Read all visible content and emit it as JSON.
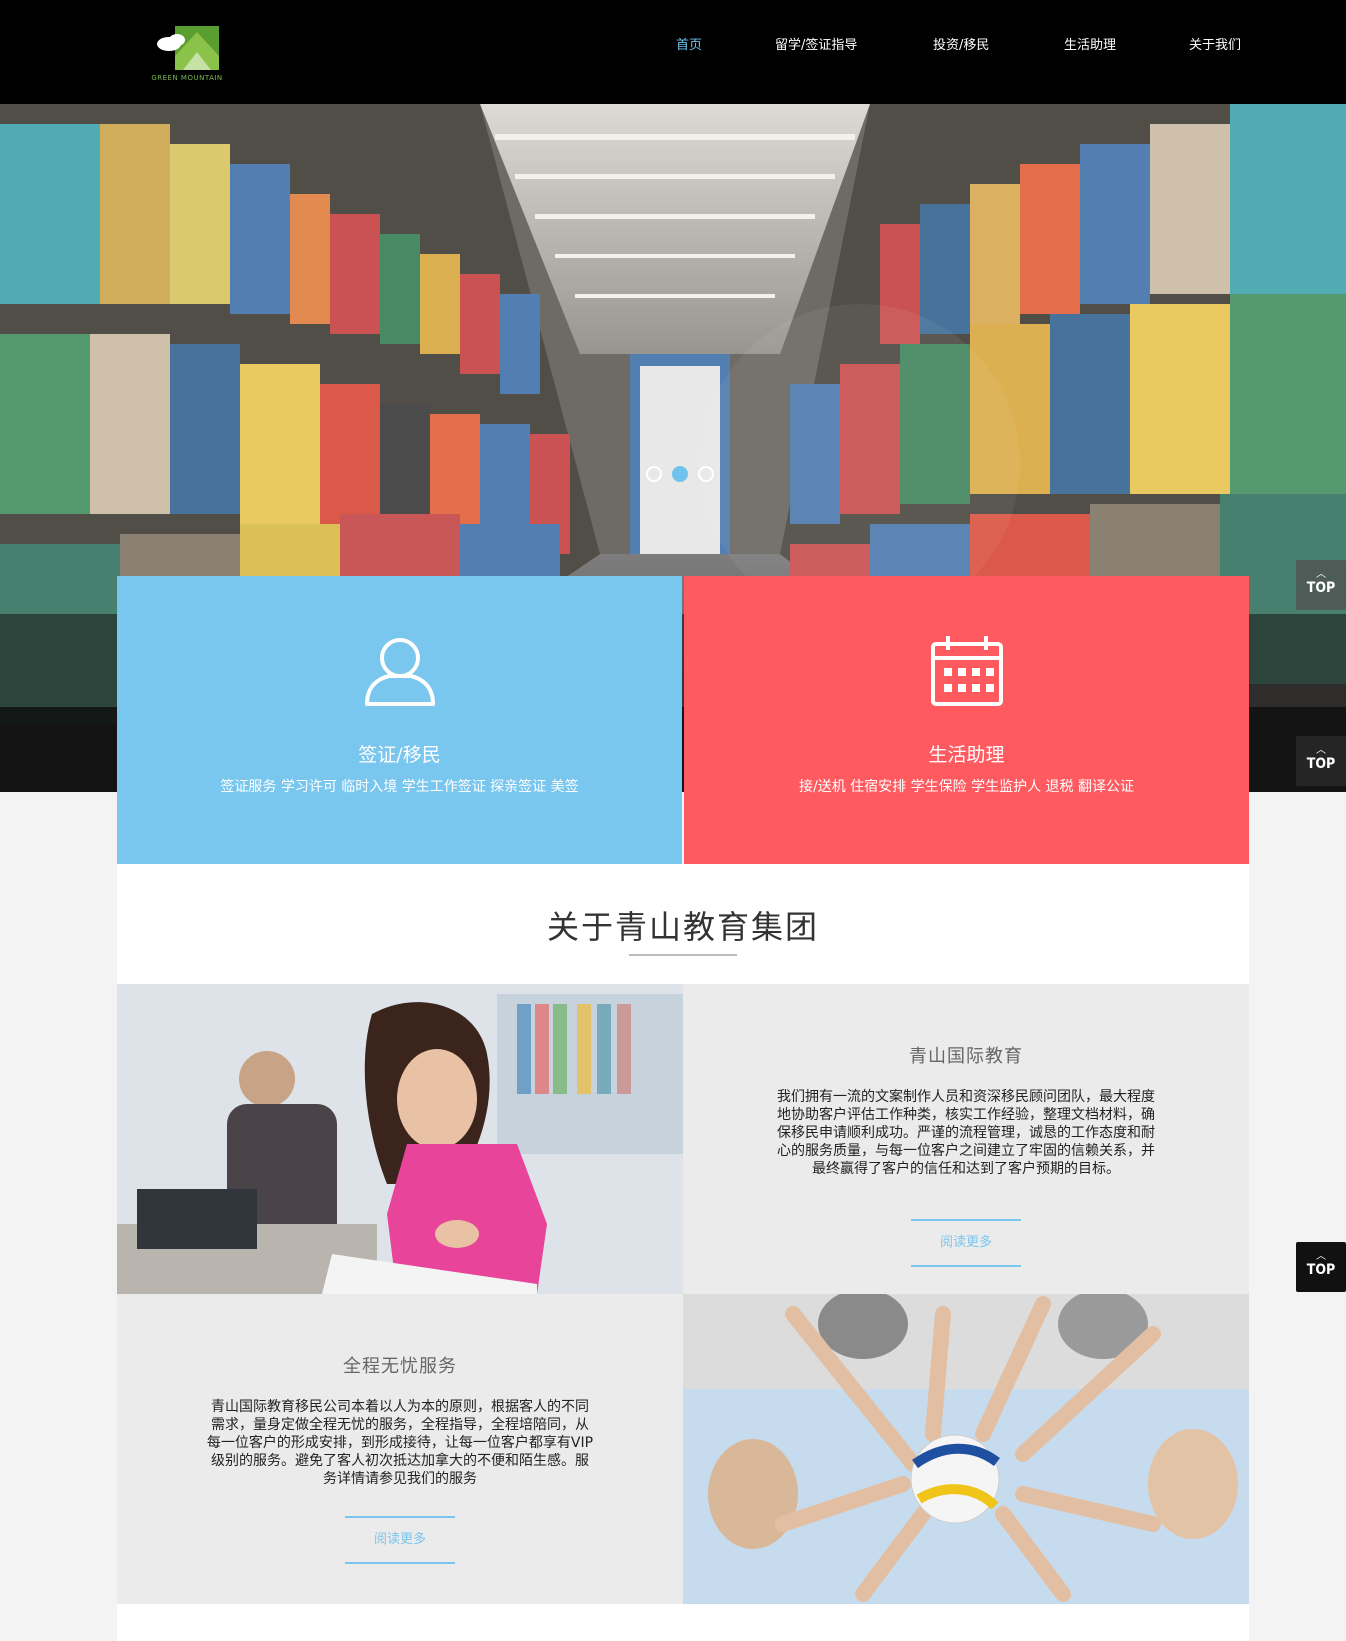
{
  "header": {
    "logo_text": "GREEN MOUNTAIN",
    "nav": [
      {
        "label": "首页",
        "active": true
      },
      {
        "label": "留学/签证指导"
      },
      {
        "label": "投资/移民"
      },
      {
        "label": "生活助理"
      },
      {
        "label": "关于我们"
      }
    ]
  },
  "hero": {
    "slides_count": 3,
    "active_slide": 2
  },
  "tiles": [
    {
      "title": "签证/移民",
      "subtitle": "签证服务 学习许可 临时入境 学生工作签证 探亲签证 美签",
      "color": "#79c6ee",
      "icon": "user-icon"
    },
    {
      "title": "生活助理",
      "subtitle": "接/送机 住宿安排 学生保险  学生监护人 退税 翻译公证",
      "color": "#ff5a60",
      "icon": "calendar-icon"
    }
  ],
  "about": {
    "title": "关于青山教育集团",
    "block1": {
      "heading": "青山国际教育",
      "body": "我们拥有一流的文案制作人员和资深移民顾问团队，最大程度地协助客户评估工作种类，核实工作经验，整理文档材料，确保移民申请顺利成功。严谨的流程管理，诚恳的工作态度和耐心的服务质量，与每一位客户之间建立了牢固的信赖关系，并最终赢得了客户的信任和达到了客户预期的目标。",
      "read_more": "阅读更多"
    },
    "block2": {
      "heading": "全程无忧服务",
      "body": "青山国际教育移民公司本着以人为本的原则，根据客人的不同需求，量身定做全程无忧的服务，全程指导，全程培陪同，从每一位客户的形成安排，到形成接待，让每一位客户都享有VIP级别的服务。避免了客人初次抵达加拿大的不便和陌生感。服务详情请参见我们的服务",
      "read_more": "阅读更多"
    }
  },
  "top_buttons": [
    "TOP",
    "TOP",
    "TOP"
  ],
  "colors": {
    "accent_blue": "#79c6ee",
    "accent_red": "#ff5a60",
    "brand_green": "#7bb84a"
  }
}
